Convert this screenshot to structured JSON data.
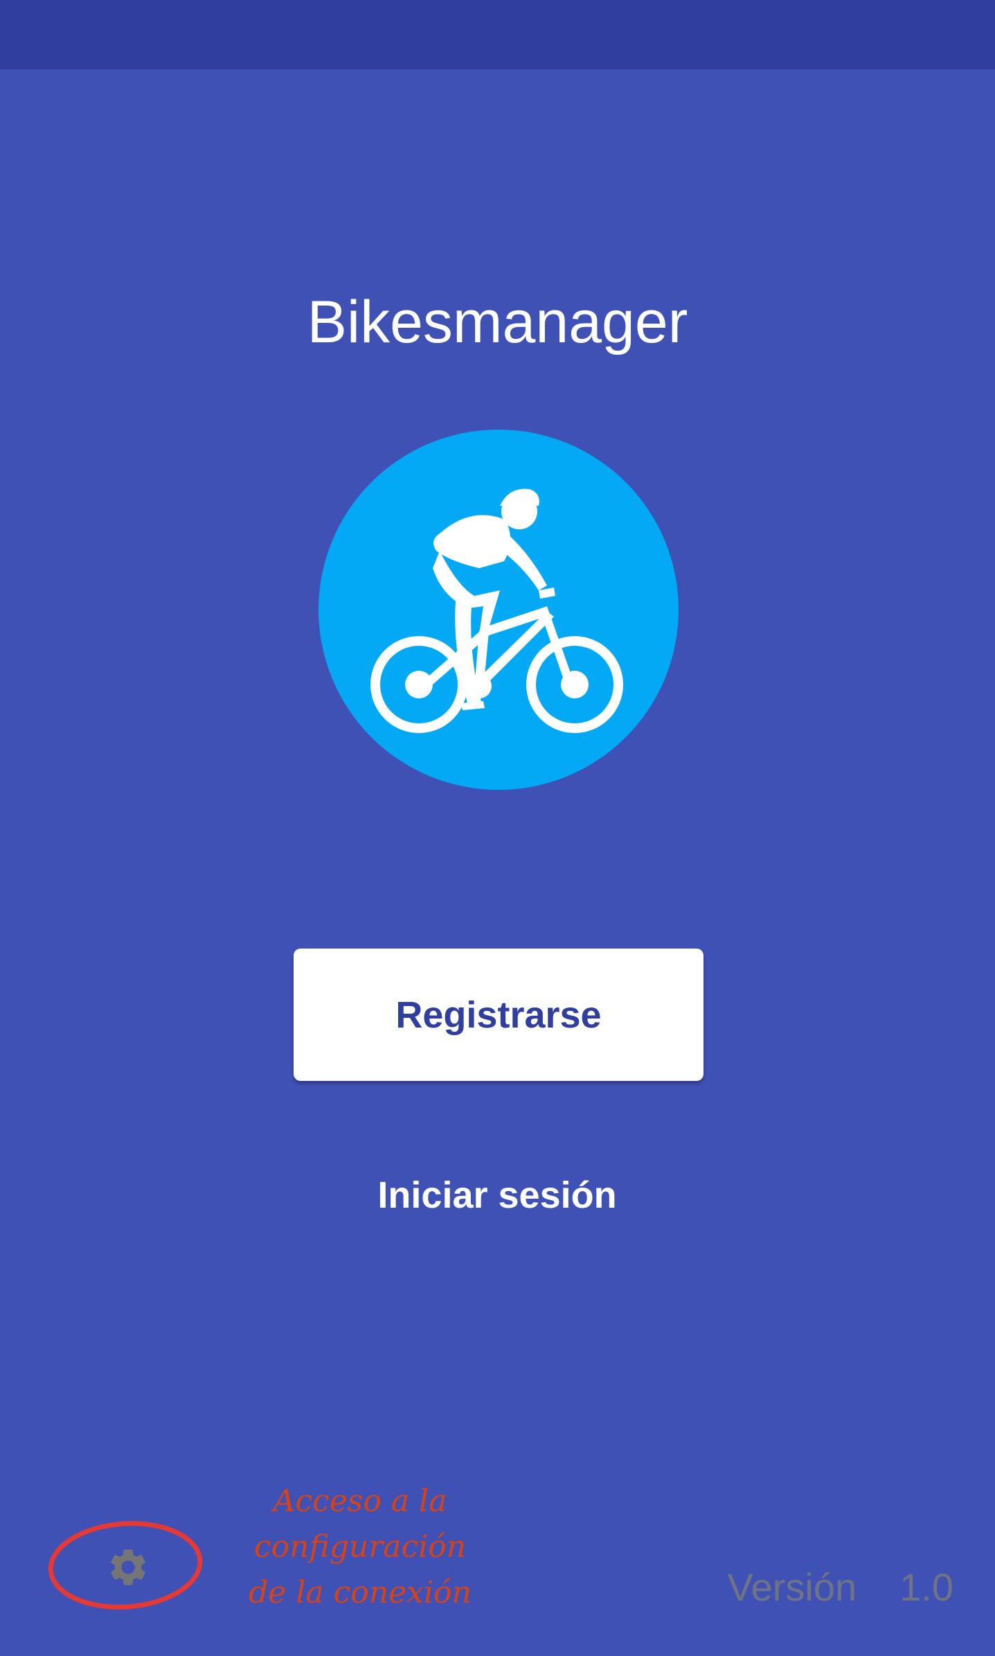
{
  "app": {
    "title": "Bikesmanager",
    "logo_icon": "cyclist-icon"
  },
  "actions": {
    "register_label": "Registrarse",
    "login_label": "Iniciar sesión"
  },
  "footer": {
    "settings_icon": "gear-icon",
    "annotation_lines": [
      "Acceso a la",
      "configuración",
      "de la conexión"
    ],
    "version_label": "Versión",
    "version_number": "1.0"
  },
  "colors": {
    "background": "#3f51b5",
    "status_bar": "#303f9f",
    "logo_circle": "#03a9f4",
    "button_text": "#303f9f",
    "annotation": "#d84315",
    "highlight_circle": "#e53935"
  }
}
